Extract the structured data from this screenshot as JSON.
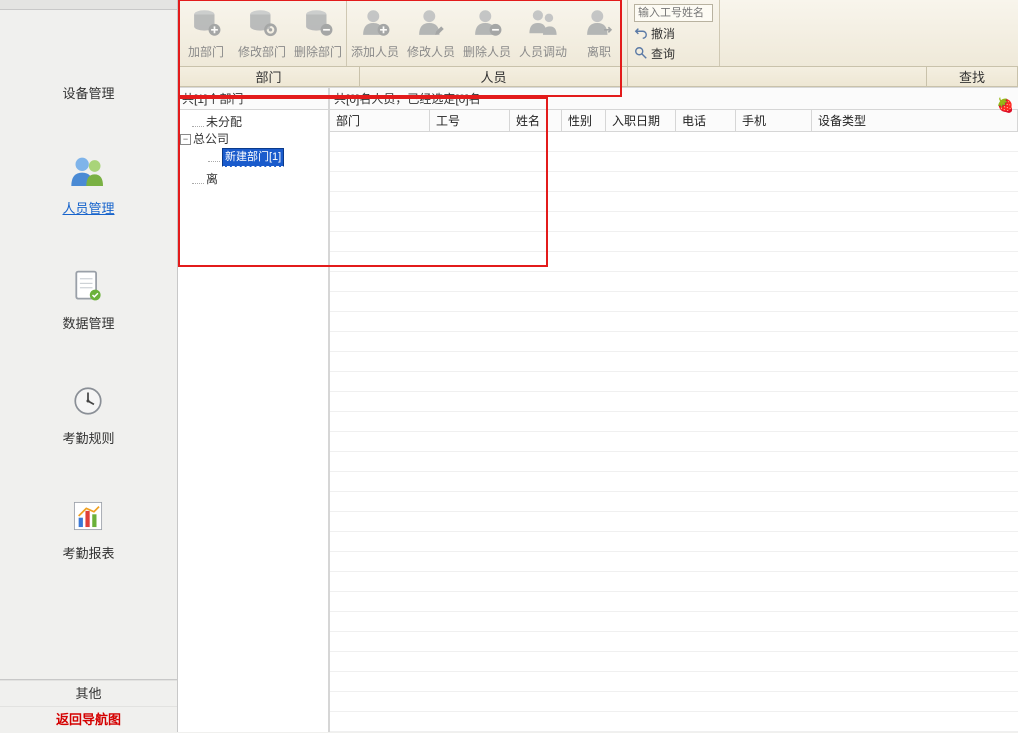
{
  "sidebar": {
    "items": [
      {
        "label": "设备管理"
      },
      {
        "label": "人员管理"
      },
      {
        "label": "数据管理"
      },
      {
        "label": "考勤规则"
      },
      {
        "label": "考勤报表"
      }
    ],
    "bottom": {
      "other": "其他",
      "nav_back": "返回导航图"
    }
  },
  "toolbar": {
    "dept_add": "加部门",
    "dept_edit": "修改部门",
    "dept_del": "删除部门",
    "person_add": "添加人员",
    "person_edit": "修改人员",
    "person_del": "删除人员",
    "person_move": "人员调动",
    "person_leave": "离职",
    "search_placeholder": "输入工号姓名",
    "revoke": "撤消",
    "query": "查询"
  },
  "subtabs": {
    "dept": "部门",
    "person": "人员",
    "find": "查找"
  },
  "tree": {
    "title": "共[1]个部门",
    "unassigned": "未分配",
    "root": "总公司",
    "new_node": "新建部门[1]",
    "leave": "离"
  },
  "list": {
    "title": "共[0]名人员，已经选定[0]名",
    "columns": {
      "dept": "部门",
      "emp_no": "工号",
      "name": "姓名",
      "gender": "性别",
      "hire_date": "入职日期",
      "phone": "电话",
      "mobile": "手机",
      "device_type": "设备类型"
    }
  }
}
